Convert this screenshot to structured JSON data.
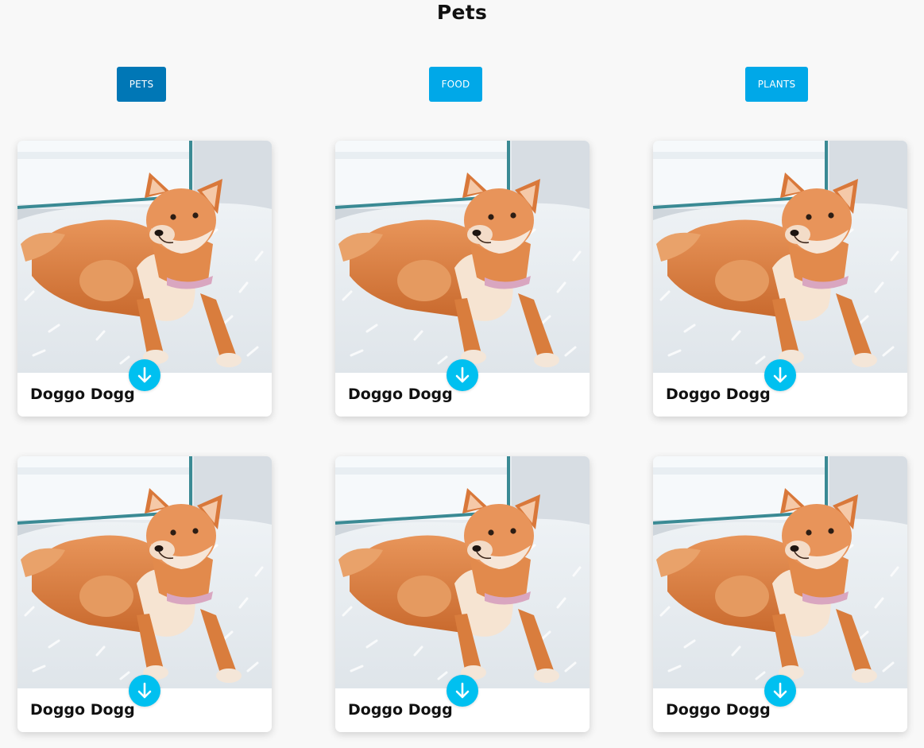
{
  "page": {
    "title": "Pets"
  },
  "tabs": [
    {
      "label": "PETS",
      "active": true
    },
    {
      "label": "FOOD",
      "active": false
    },
    {
      "label": "PLANTS",
      "active": false
    }
  ],
  "cards": [
    {
      "title": "Doggo Dogg"
    },
    {
      "title": "Doggo Dogg"
    },
    {
      "title": "Doggo Dogg"
    },
    {
      "title": "Doggo Dogg"
    },
    {
      "title": "Doggo Dogg"
    },
    {
      "title": "Doggo Dogg"
    }
  ],
  "icons": {
    "download": "arrow-down-icon"
  },
  "colors": {
    "tab_active": "#0077b6",
    "tab_default": "#00a8e8",
    "download_button": "#00c0f0",
    "background": "#f8f8f8"
  }
}
